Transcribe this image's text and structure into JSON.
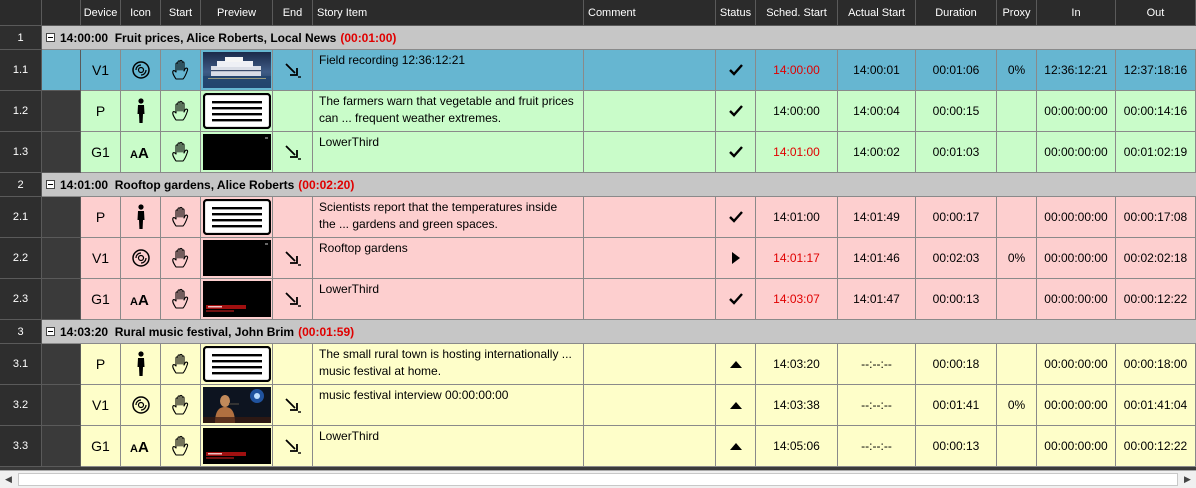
{
  "columns": [
    {
      "key": "num",
      "label": ""
    },
    {
      "key": "gutter",
      "label": ""
    },
    {
      "key": "device",
      "label": "Device"
    },
    {
      "key": "icon",
      "label": "Icon"
    },
    {
      "key": "start",
      "label": "Start"
    },
    {
      "key": "preview",
      "label": "Preview"
    },
    {
      "key": "end",
      "label": "End"
    },
    {
      "key": "story",
      "label": "Story Item"
    },
    {
      "key": "comment",
      "label": "Comment"
    },
    {
      "key": "status",
      "label": "Status"
    },
    {
      "key": "sched",
      "label": "Sched. Start"
    },
    {
      "key": "actual",
      "label": "Actual Start"
    },
    {
      "key": "duration",
      "label": "Duration"
    },
    {
      "key": "proxy",
      "label": "Proxy"
    },
    {
      "key": "in",
      "label": "In"
    },
    {
      "key": "out",
      "label": "Out"
    }
  ],
  "colors": {
    "selected": "#66b6d1",
    "green": "#c9fcc9",
    "pink": "#fdcfcf",
    "yellow": "#fefec9",
    "group": "#c6c6c6",
    "red_text": "#e00000"
  },
  "groups": [
    {
      "num": "1",
      "time": "14:00:00",
      "title": "Fruit prices, Alice Roberts, Local News",
      "duration": "(00:01:00)",
      "color": "green",
      "rows": [
        {
          "num": "1.1",
          "device": "V1",
          "icon": "video-disc-icon",
          "start": "manual-hand-icon",
          "preview": "ferry-thumbnail",
          "end": "auto-end-arrow-icon",
          "story": "Field recording 12:36:12:21",
          "comment": "",
          "status": "check-icon",
          "sched": "14:00:00",
          "sched_red": true,
          "actual": "14:00:01",
          "duration": "00:01:06",
          "proxy": "0%",
          "in": "12:36:12:21",
          "out": "12:37:18:16",
          "selected": true
        },
        {
          "num": "1.2",
          "device": "P",
          "icon": "presenter-icon",
          "start": "manual-hand-icon",
          "preview": "script-thumbnail",
          "end": "",
          "story": "The farmers warn that vegetable and fruit prices can ... frequent weather extremes.",
          "comment": "",
          "status": "check-icon",
          "sched": "14:00:00",
          "sched_red": false,
          "actual": "14:00:04",
          "duration": "00:00:15",
          "proxy": "",
          "in": "00:00:00:00",
          "out": "00:00:14:16",
          "selected": false
        },
        {
          "num": "1.3",
          "device": "G1",
          "icon": "graphics-aa-icon",
          "start": "manual-hand-icon",
          "preview": "black-thumbnail",
          "end": "auto-end-arrow-icon",
          "story": "LowerThird",
          "comment": "",
          "status": "check-icon",
          "sched": "14:01:00",
          "sched_red": true,
          "actual": "14:00:02",
          "duration": "00:01:03",
          "proxy": "",
          "in": "00:00:00:00",
          "out": "00:01:02:19",
          "selected": false
        }
      ]
    },
    {
      "num": "2",
      "time": "14:01:00",
      "title": "Rooftop gardens, Alice Roberts",
      "duration": "(00:02:20)",
      "color": "pink",
      "rows": [
        {
          "num": "2.1",
          "device": "P",
          "icon": "presenter-icon",
          "start": "manual-hand-icon",
          "preview": "script-thumbnail",
          "end": "",
          "story": "Scientists report that the temperatures inside the ... gardens and green spaces.",
          "comment": "",
          "status": "check-icon",
          "sched": "14:01:00",
          "sched_red": false,
          "actual": "14:01:49",
          "duration": "00:00:17",
          "proxy": "",
          "in": "00:00:00:00",
          "out": "00:00:17:08",
          "selected": false
        },
        {
          "num": "2.2",
          "device": "V1",
          "icon": "video-disc-icon",
          "start": "manual-hand-icon",
          "preview": "black-thumbnail",
          "end": "auto-end-arrow-icon",
          "story": "Rooftop gardens",
          "comment": "",
          "status": "play-icon",
          "sched": "14:01:17",
          "sched_red": true,
          "actual": "14:01:46",
          "duration": "00:02:03",
          "proxy": "0%",
          "in": "00:00:00:00",
          "out": "00:02:02:18",
          "selected": false
        },
        {
          "num": "2.3",
          "device": "G1",
          "icon": "graphics-aa-icon",
          "start": "manual-hand-icon",
          "preview": "lowerthird-thumbnail",
          "end": "auto-end-arrow-icon",
          "story": "LowerThird",
          "comment": "",
          "status": "check-icon",
          "sched": "14:03:07",
          "sched_red": true,
          "actual": "14:01:47",
          "duration": "00:00:13",
          "proxy": "",
          "in": "00:00:00:00",
          "out": "00:00:12:22",
          "selected": false
        }
      ]
    },
    {
      "num": "3",
      "time": "14:03:20",
      "title": "Rural music festival, John Brim",
      "duration": "(00:01:59)",
      "color": "yellow",
      "rows": [
        {
          "num": "3.1",
          "device": "P",
          "icon": "presenter-icon",
          "start": "manual-hand-icon",
          "preview": "script-thumbnail",
          "end": "",
          "story": "The small rural town is hosting internationally ... music festival at home.",
          "comment": "",
          "status": "up-triangle-icon",
          "sched": "14:03:20",
          "sched_red": false,
          "actual": "--:--:--",
          "duration": "00:00:18",
          "proxy": "",
          "in": "00:00:00:00",
          "out": "00:00:18:00",
          "selected": false
        },
        {
          "num": "3.2",
          "device": "V1",
          "icon": "video-disc-icon",
          "start": "manual-hand-icon",
          "preview": "singer-thumbnail",
          "end": "auto-end-arrow-icon",
          "story": "music festival interview 00:00:00:00",
          "comment": "",
          "status": "up-triangle-icon",
          "sched": "14:03:38",
          "sched_red": false,
          "actual": "--:--:--",
          "duration": "00:01:41",
          "proxy": "0%",
          "in": "00:00:00:00",
          "out": "00:01:41:04",
          "selected": false
        },
        {
          "num": "3.3",
          "device": "G1",
          "icon": "graphics-aa-icon",
          "start": "manual-hand-icon",
          "preview": "lowerthird-thumbnail",
          "end": "auto-end-arrow-icon",
          "story": "LowerThird",
          "comment": "",
          "status": "up-triangle-icon",
          "sched": "14:05:06",
          "sched_red": false,
          "actual": "--:--:--",
          "duration": "00:00:13",
          "proxy": "",
          "in": "00:00:00:00",
          "out": "00:00:12:22",
          "selected": false
        }
      ]
    }
  ]
}
